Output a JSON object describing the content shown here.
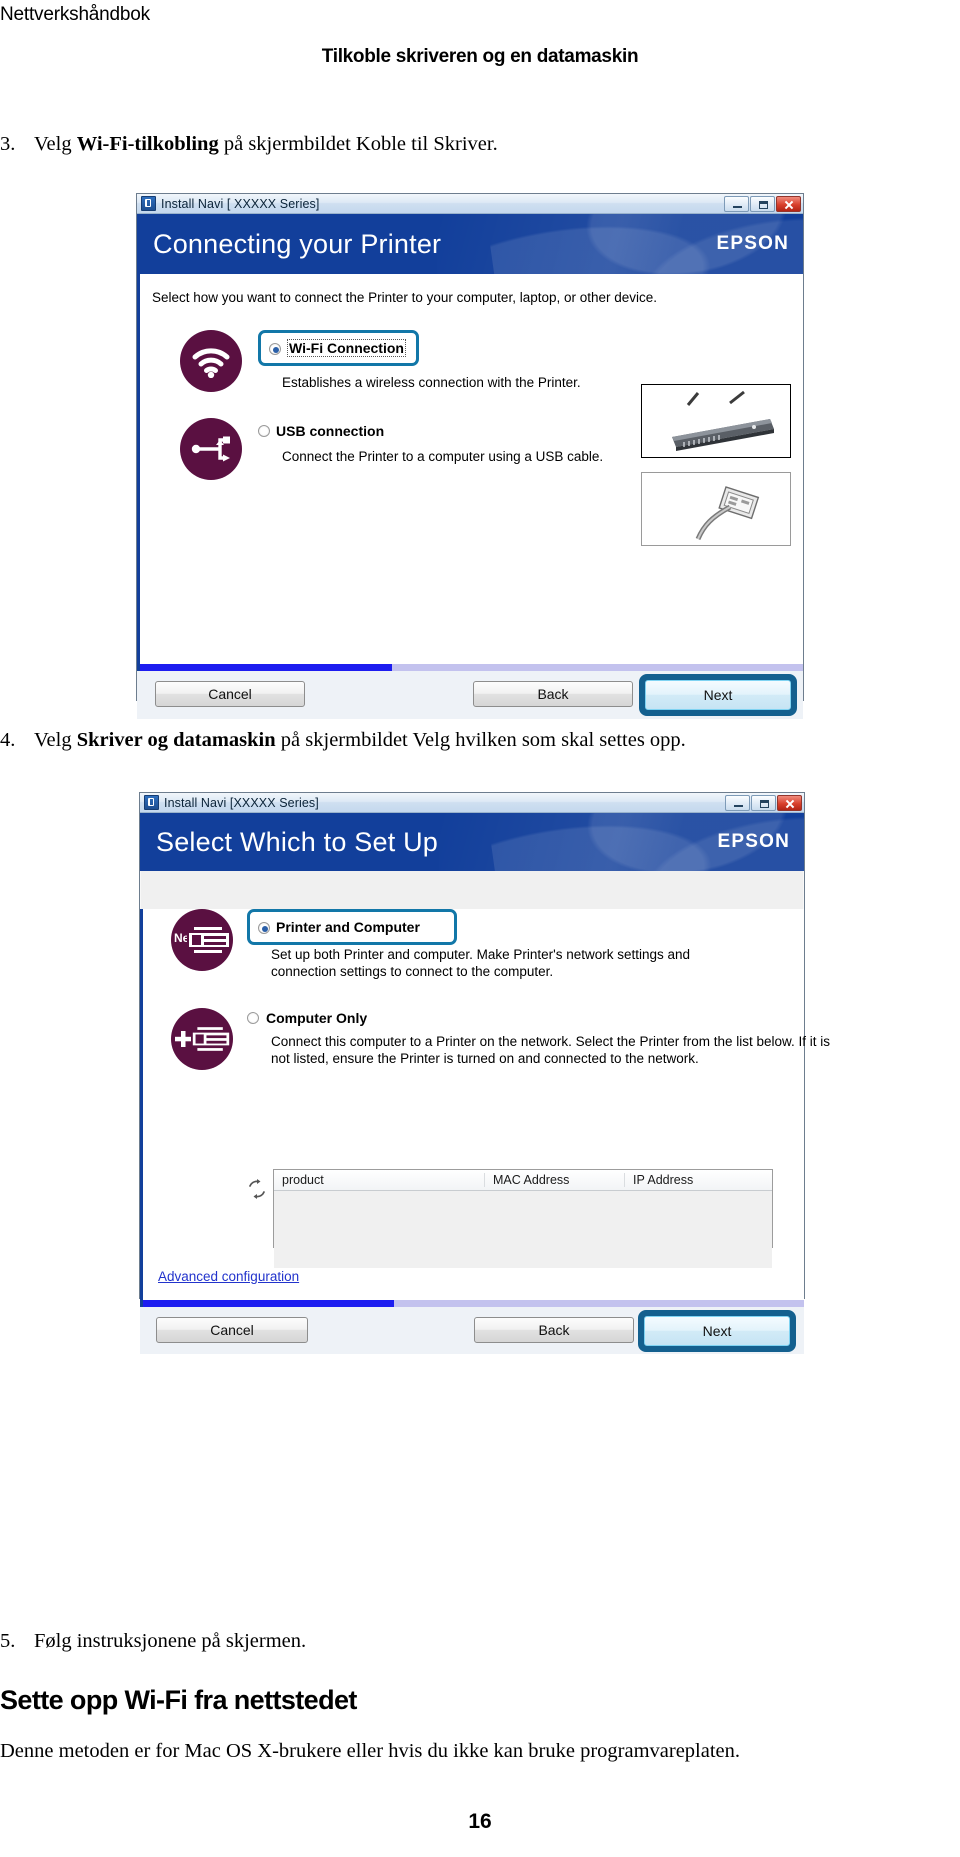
{
  "document": {
    "running_head": "Nettverkshåndbok",
    "title": "Tilkoble skriveren og en datamaskin",
    "page_number": "16"
  },
  "steps": [
    {
      "number": "3.",
      "text_before": "Velg ",
      "bold": "Wi-Fi-tilkobling",
      "text_after": " på skjermbildet Koble til Skriver."
    },
    {
      "number": "4.",
      "text_before": "Velg ",
      "bold": "Skriver og datamaskin",
      "text_after": " på skjermbildet Velg hvilken som skal settes opp."
    },
    {
      "number": "5.",
      "text_before": "Følg instruksjonene på skjermen.",
      "bold": "",
      "text_after": ""
    }
  ],
  "section": {
    "heading": "Sette opp Wi-Fi fra nettstedet",
    "paragraph": "Denne metoden er for Mac OS X-brukere eller hvis du ikke kan bruke programvareplaten."
  },
  "dialog1": {
    "titlebar": "Install Navi [  XXXXX  Series]",
    "banner_title": "Connecting your Printer",
    "brand": "EPSON",
    "intro": "Select how you want to connect the Printer to your computer, laptop, or other device.",
    "options": [
      {
        "label": "Wi-Fi Connection",
        "description": "Establishes a wireless connection with the Printer.",
        "selected": true,
        "highlighted": true,
        "icon": "wifi-icon"
      },
      {
        "label": "USB connection",
        "description": "Connect the Printer to a computer using a USB cable.",
        "selected": false,
        "highlighted": false,
        "icon": "usb-icon"
      }
    ],
    "progress_percent": 38,
    "buttons": {
      "cancel": "Cancel",
      "back": "Back",
      "next": "Next"
    },
    "window_controls": {
      "minimize": "minimize-icon",
      "maximize": "maximize-icon",
      "close": "close-icon"
    }
  },
  "dialog2": {
    "titlebar": "Install Navi [XXXXX    Series]",
    "banner_title": "Select Which to Set Up",
    "brand": "EPSON",
    "options": [
      {
        "badge": "New",
        "label": "Printer and Computer",
        "description": "Set up both Printer and computer. Make Printer's network settings and connection settings to connect to the computer.",
        "selected": true,
        "highlighted": true,
        "icon": "printer-new-icon"
      },
      {
        "badge": "+",
        "label": "Computer Only",
        "description": "Connect this computer to a Printer on the network. Select the Printer from the list below. If it is not listed, ensure the Printer is turned on and connected to the network.",
        "selected": false,
        "highlighted": false,
        "icon": "printer-add-icon"
      }
    ],
    "table": {
      "columns": [
        "product",
        "MAC Address",
        "IP Address"
      ],
      "rows": []
    },
    "advanced_link": "Advanced configuration",
    "progress_percent": 38,
    "buttons": {
      "cancel": "Cancel",
      "back": "Back",
      "next": "Next"
    },
    "window_controls": {
      "minimize": "minimize-icon",
      "maximize": "maximize-icon",
      "close": "close-icon"
    }
  }
}
